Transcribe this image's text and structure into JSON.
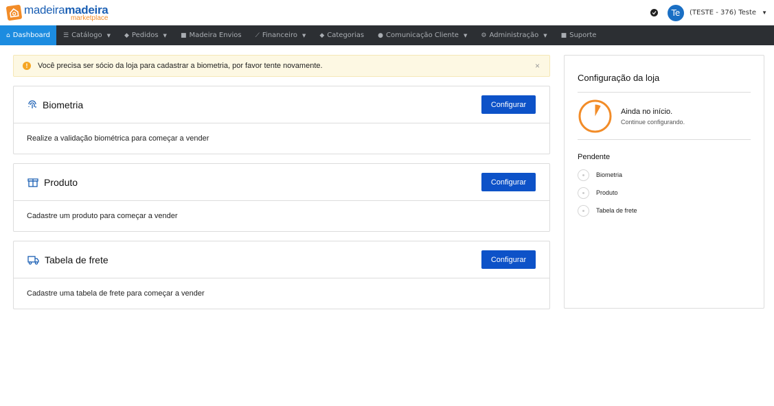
{
  "brand": {
    "name_light": "madeira",
    "name_bold": "madeira",
    "sub": "marketplace",
    "colors": {
      "primary": "#1a5fb4",
      "accent": "#f28c28"
    }
  },
  "user": {
    "avatar_initials": "Te",
    "name": "(TESTE - 376) Teste"
  },
  "nav": {
    "items": [
      {
        "label": "Dashboard",
        "icon": "home-icon"
      },
      {
        "label": "Catálogo",
        "icon": "list-icon"
      },
      {
        "label": "Pedidos",
        "icon": "tag-icon"
      },
      {
        "label": "Madeira Envios",
        "icon": "truck-icon"
      },
      {
        "label": "Financeiro",
        "icon": "chart-icon"
      },
      {
        "label": "Categorias",
        "icon": "tag-icon"
      },
      {
        "label": "Comunicação Cliente",
        "icon": "chat-icon"
      },
      {
        "label": "Administração",
        "icon": "gear-icon"
      },
      {
        "label": "Suporte",
        "icon": "message-icon"
      }
    ]
  },
  "alert": {
    "text": "Você precisa ser sócio da loja para cadastrar a biometria, por favor tente novamente.",
    "close": "×",
    "color": "#f5a623"
  },
  "cards": [
    {
      "title": "Biometria",
      "button": "Configurar",
      "body": "Realize a validação biométrica para começar a vender",
      "icon": "fingerprint-icon"
    },
    {
      "title": "Produto",
      "button": "Configurar",
      "body": "Cadastre um produto para começar a vender",
      "icon": "box-icon"
    },
    {
      "title": "Tabela de frete",
      "button": "Configurar",
      "body": "Cadastre uma tabela de frete para começar a vender",
      "icon": "truck-icon"
    }
  ],
  "panel": {
    "title": "Configuração da loja",
    "status_main": "Ainda no início.",
    "status_sub": "Continue configurando.",
    "progress": 0.08,
    "pending_title": "Pendente",
    "pending": [
      "Biometria",
      "Produto",
      "Tabela de frete"
    ]
  }
}
